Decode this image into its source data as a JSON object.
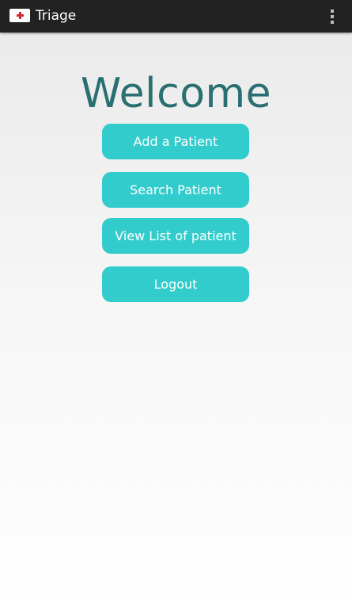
{
  "action_bar": {
    "title": "Triage",
    "app_icon": "red-cross-icon",
    "menu_icon": "overflow-menu-icon"
  },
  "main": {
    "heading": "Welcome",
    "buttons": {
      "add_patient": "Add a Patient",
      "search_patient": "Search Patient",
      "view_list": "View List of patient",
      "logout": "Logout"
    }
  },
  "colors": {
    "accent": "#33cccc",
    "heading": "#2a6f72",
    "action_bar": "#222222"
  }
}
